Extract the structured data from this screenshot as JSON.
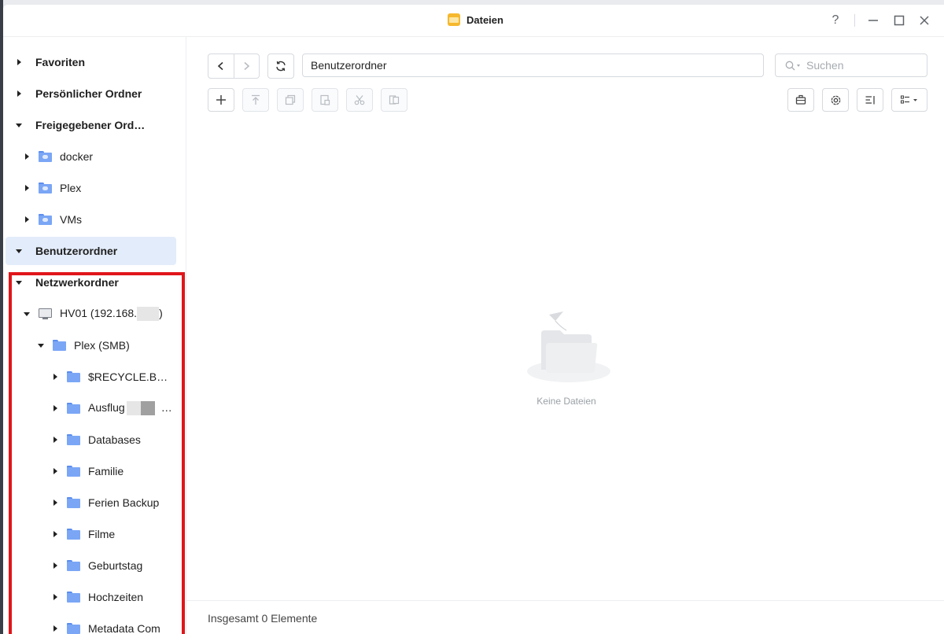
{
  "window": {
    "title": "Dateien",
    "help_label": "?"
  },
  "sidebar": {
    "items": [
      {
        "label": "Favoriten",
        "caret": "right",
        "bold": true,
        "depth": 0,
        "icon": "none"
      },
      {
        "label": "Persönlicher Ordner",
        "caret": "right",
        "bold": true,
        "depth": 0,
        "icon": "none"
      },
      {
        "label": "Freigegebener Ord…",
        "caret": "down",
        "bold": true,
        "depth": 0,
        "icon": "none"
      },
      {
        "label": "docker",
        "caret": "right",
        "bold": false,
        "depth": 1,
        "icon": "shared-folder-icon"
      },
      {
        "label": "Plex",
        "caret": "right",
        "bold": false,
        "depth": 1,
        "icon": "shared-folder-icon"
      },
      {
        "label": "VMs",
        "caret": "right",
        "bold": false,
        "depth": 1,
        "icon": "shared-folder-icon"
      },
      {
        "label": "Benutzerordner",
        "caret": "down",
        "bold": true,
        "depth": 0,
        "icon": "none",
        "selected": true
      },
      {
        "label": "Netzwerkordner",
        "caret": "down",
        "bold": true,
        "depth": 0,
        "icon": "none"
      },
      {
        "label": "HV01 (192.168.",
        "label_suffix": ")",
        "caret": "down",
        "bold": false,
        "depth": 1,
        "icon": "computer-icon",
        "redacted": true
      },
      {
        "label": "Plex (SMB)",
        "caret": "down",
        "bold": false,
        "depth": 2,
        "icon": "folder-icon"
      },
      {
        "label": "$RECYCLE.B…",
        "caret": "right",
        "bold": false,
        "depth": 3,
        "icon": "folder-icon"
      },
      {
        "label": "Ausflug",
        "label_suffix": "…",
        "caret": "right",
        "bold": false,
        "depth": 3,
        "icon": "folder-icon",
        "redacted": true
      },
      {
        "label": "Databases",
        "caret": "right",
        "bold": false,
        "depth": 3,
        "icon": "folder-icon"
      },
      {
        "label": "Familie",
        "caret": "right",
        "bold": false,
        "depth": 3,
        "icon": "folder-icon"
      },
      {
        "label": "Ferien Backup",
        "caret": "right",
        "bold": false,
        "depth": 3,
        "icon": "folder-icon"
      },
      {
        "label": "Filme",
        "caret": "right",
        "bold": false,
        "depth": 3,
        "icon": "folder-icon"
      },
      {
        "label": "Geburtstag",
        "caret": "right",
        "bold": false,
        "depth": 3,
        "icon": "folder-icon"
      },
      {
        "label": "Hochzeiten",
        "caret": "right",
        "bold": false,
        "depth": 3,
        "icon": "folder-icon"
      },
      {
        "label": "Metadata Com",
        "caret": "right",
        "bold": false,
        "depth": 3,
        "icon": "folder-icon"
      }
    ]
  },
  "main": {
    "path": "Benutzerordner",
    "search_placeholder": "Suchen",
    "empty_text": "Keine Dateien",
    "status": "Insgesamt 0 Elemente"
  },
  "colors": {
    "accent": "#e3ecfa",
    "highlight_border": "#e0161b",
    "folder": "#7aa6f5"
  }
}
